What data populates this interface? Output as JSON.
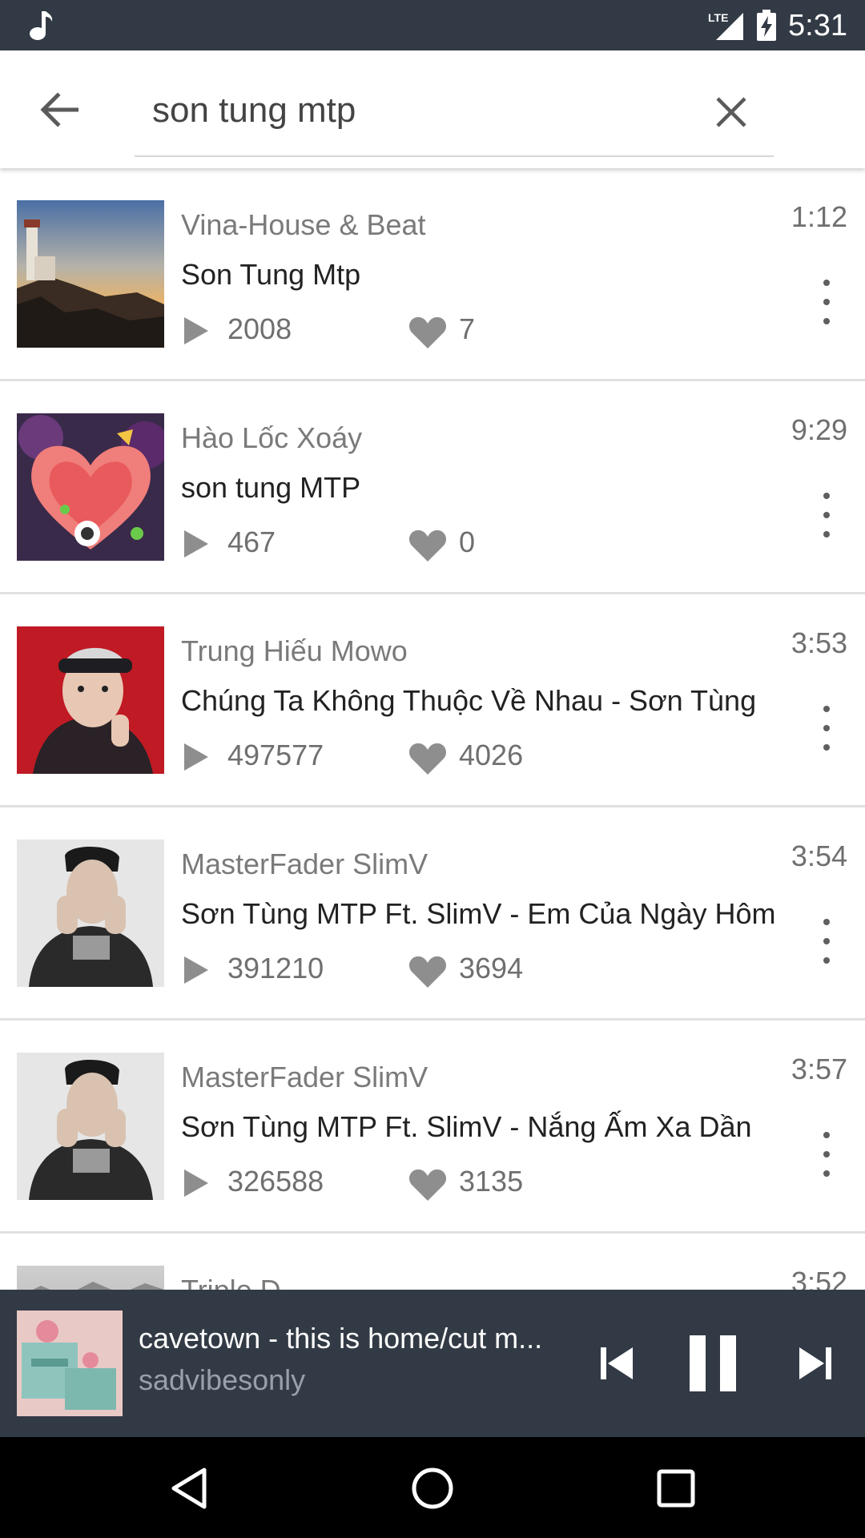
{
  "status_bar": {
    "time": "5:31",
    "network": "LTE",
    "icons": [
      "music-note-icon",
      "lte-signal-icon",
      "battery-charging-icon"
    ]
  },
  "search": {
    "query": "son tung mtp",
    "back_icon": "arrow-back-icon",
    "clear_icon": "close-icon"
  },
  "results": [
    {
      "artist": "Vina-House & Beat",
      "title": "Son Tung Mtp",
      "plays": "2008",
      "likes": "7",
      "duration": "1:12"
    },
    {
      "artist": "Hào Lốc Xoáy",
      "title": "son tung MTP",
      "plays": "467",
      "likes": "0",
      "duration": "9:29"
    },
    {
      "artist": "Trung Hiếu Mowo",
      "title": "Chúng Ta Không Thuộc Về Nhau - Sơn Tùng",
      "plays": "497577",
      "likes": "4026",
      "duration": "3:53"
    },
    {
      "artist": "MasterFader SlimV",
      "title": "Sơn Tùng MTP Ft. SlimV - Em Của Ngày Hôm",
      "plays": "391210",
      "likes": "3694",
      "duration": "3:54"
    },
    {
      "artist": "MasterFader SlimV",
      "title": "Sơn Tùng MTP Ft. SlimV - Nắng Ấm Xa Dần",
      "plays": "326588",
      "likes": "3135",
      "duration": "3:57"
    },
    {
      "artist": "Triple D",
      "title": "",
      "plays": "",
      "likes": "",
      "duration": "3:52"
    }
  ],
  "now_playing": {
    "title": "cavetown - this is home/cut m...",
    "artist": "sadvibesonly",
    "controls": [
      "skip-previous-icon",
      "pause-icon",
      "skip-next-icon"
    ]
  },
  "nav_bar": {
    "buttons": [
      "nav-back-icon",
      "nav-home-icon",
      "nav-recents-icon"
    ]
  },
  "colors": {
    "status_bar_bg": "#323a45",
    "player_bg": "#323a45",
    "nav_bar_bg": "#000000",
    "secondary_text": "#7a7a7a"
  }
}
